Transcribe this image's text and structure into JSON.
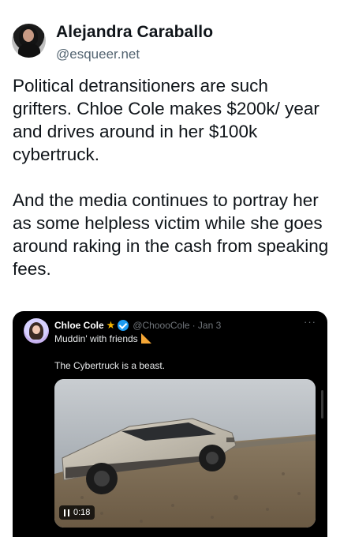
{
  "post": {
    "display_name": "Alejandra Caraballo",
    "handle": "@esqueer.net",
    "text": "Political detransitioners are such grifters. Chloe Cole makes $200k/ year and drives around in her $100k cybertruck.\n\nAnd the media continues to portray her as some helpless victim while she goes around raking in the cash from speaking fees."
  },
  "quote": {
    "display_name": "Chloe Cole",
    "handle": "@ChoooCole",
    "date": "· Jan 3",
    "line1": "Muddin' with friends",
    "line2": "The Cybertruck is a beast.",
    "video_time": "0:18",
    "more_label": "···"
  },
  "icons": {
    "star": "star-icon",
    "verified": "verified-icon",
    "ruler": "triangular-ruler-icon",
    "pause": "pause-icon",
    "more": "more-icon"
  },
  "colors": {
    "verified_blue": "#1d9bf0",
    "handle_gray": "#536471",
    "quote_bg": "#000000"
  }
}
